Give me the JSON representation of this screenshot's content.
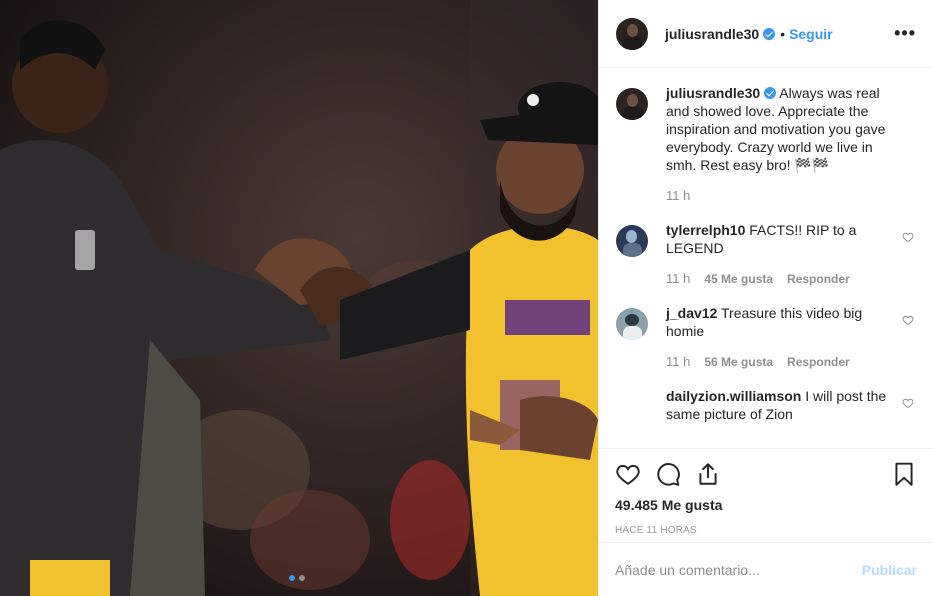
{
  "post": {
    "photo_icon": "photo-two-people-handshake",
    "carousel": {
      "count": 2,
      "active_index": 0
    }
  },
  "header": {
    "username": "juliusrandle30",
    "separator": "•",
    "follow_label": "Seguir",
    "more_icon": "more-horizontal-icon",
    "more_label": "•••"
  },
  "caption": {
    "username": "juliusrandle30",
    "text": "Always was real and showed love. Appreciate the inspiration and motivation you gave everybody. Crazy world we live in smh. Rest easy bro! 🏁🏁",
    "time": "11 h"
  },
  "comments": [
    {
      "username": "tylerrelph10",
      "text": "FACTS!! RIP to a LEGEND",
      "time": "11 h",
      "likes": "45 Me gusta",
      "reply": "Responder"
    },
    {
      "username": "j_dav12",
      "text": "Treasure this video big homie",
      "time": "11 h",
      "likes": "56 Me gusta",
      "reply": "Responder"
    },
    {
      "username": "dailyzion.williamson",
      "text": "I will post the same picture of Zion"
    }
  ],
  "actions": {
    "like_icon": "heart-icon",
    "comment_icon": "comment-icon",
    "share_icon": "share-icon",
    "save_icon": "bookmark-icon"
  },
  "likes_text": "49.485 Me gusta",
  "posted_ago": "HACE 11 HORAS",
  "composer": {
    "placeholder": "Añade un comentario...",
    "publish_label": "Publicar"
  },
  "colors": {
    "accent": "#3897f0",
    "publish_disabled": "#b3dbff",
    "muted": "#8e8e8e",
    "jersey": "#f2c12e"
  }
}
